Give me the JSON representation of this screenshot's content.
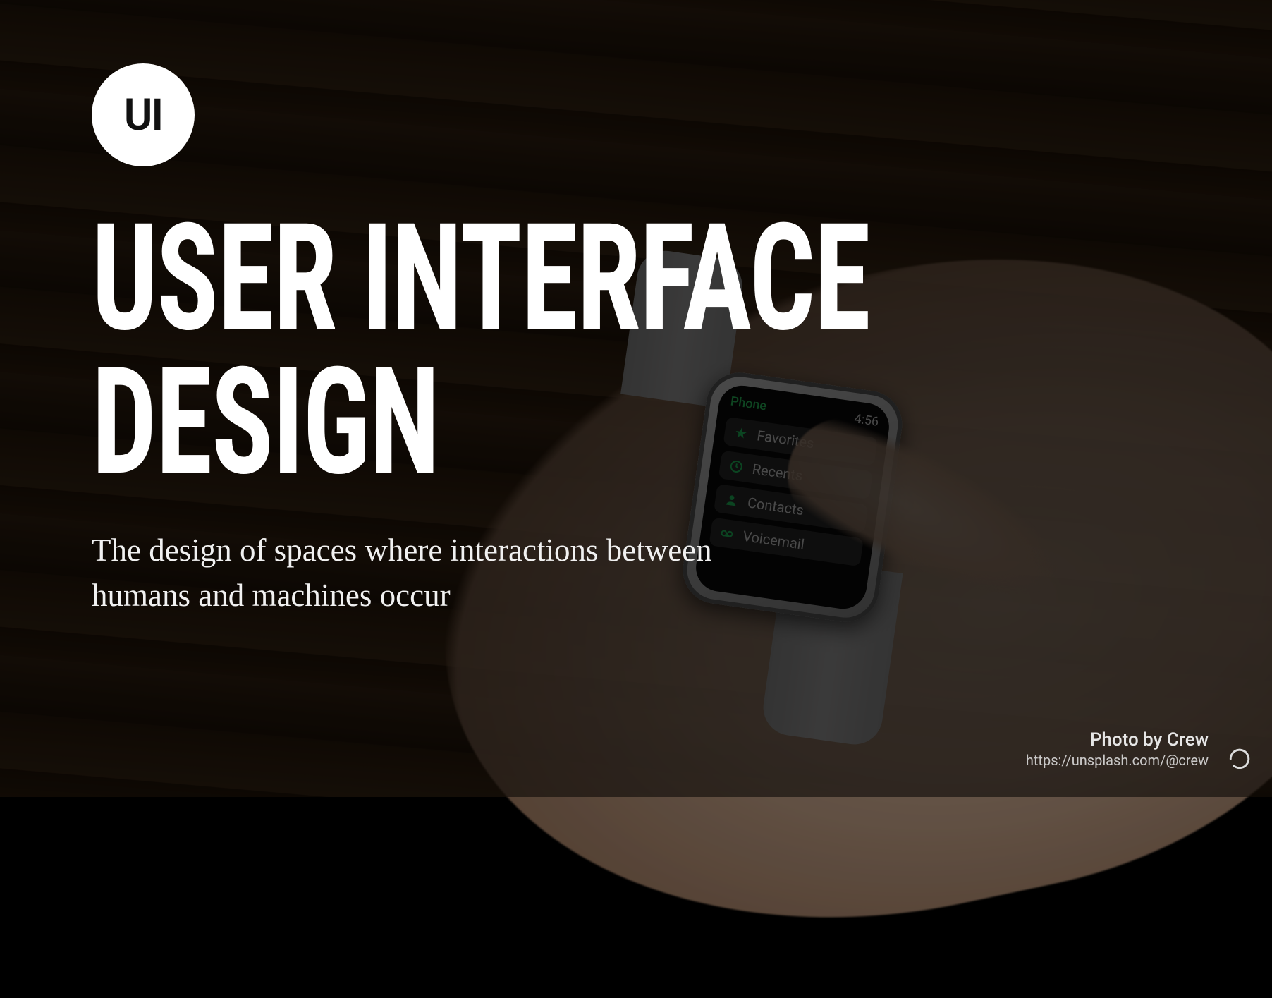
{
  "badge": {
    "label": "UI"
  },
  "title": "USER INTERFACE\nDESIGN",
  "subtitle": "The design of spaces where interactions between humans and machines occur",
  "watch": {
    "app": "Phone",
    "time": "4:56",
    "items": [
      {
        "icon": "star-icon",
        "label": "Favorites"
      },
      {
        "icon": "clock-icon",
        "label": "Recents"
      },
      {
        "icon": "contact-icon",
        "label": "Contacts"
      },
      {
        "icon": "voicemail-icon",
        "label": "Voicemail"
      }
    ]
  },
  "credit": {
    "line1": "Photo by Crew",
    "line2": "https://unsplash.com/@crew"
  },
  "colors": {
    "accent_green": "#25d968",
    "text_white": "#ffffff"
  }
}
